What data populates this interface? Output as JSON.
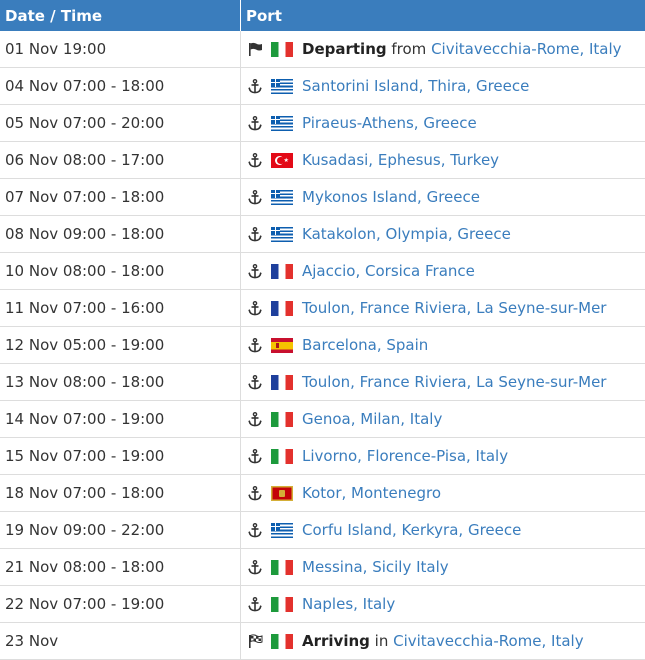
{
  "header": {
    "date_col": "Date / Time",
    "port_col": "Port"
  },
  "rows": [
    {
      "datetime": "01 Nov 19:00",
      "icon": "flag-icon",
      "flag": "it",
      "bold": "Departing",
      "pre": " from ",
      "port": "Civitavecchia-Rome, Italy"
    },
    {
      "datetime": "04 Nov 07:00 - 18:00",
      "icon": "anchor-icon",
      "flag": "gr",
      "bold": "",
      "pre": "",
      "port": "Santorini Island, Thira, Greece"
    },
    {
      "datetime": "05 Nov 07:00 - 20:00",
      "icon": "anchor-icon",
      "flag": "gr",
      "bold": "",
      "pre": "",
      "port": "Piraeus-Athens, Greece"
    },
    {
      "datetime": "06 Nov 08:00 - 17:00",
      "icon": "anchor-icon",
      "flag": "tr",
      "bold": "",
      "pre": "",
      "port": "Kusadasi, Ephesus, Turkey"
    },
    {
      "datetime": "07 Nov 07:00 - 18:00",
      "icon": "anchor-icon",
      "flag": "gr",
      "bold": "",
      "pre": "",
      "port": "Mykonos Island, Greece"
    },
    {
      "datetime": "08 Nov 09:00 - 18:00",
      "icon": "anchor-icon",
      "flag": "gr",
      "bold": "",
      "pre": "",
      "port": "Katakolon, Olympia, Greece"
    },
    {
      "datetime": "10 Nov 08:00 - 18:00",
      "icon": "anchor-icon",
      "flag": "fr",
      "bold": "",
      "pre": "",
      "port": "Ajaccio, Corsica France"
    },
    {
      "datetime": "11 Nov 07:00 - 16:00",
      "icon": "anchor-icon",
      "flag": "fr",
      "bold": "",
      "pre": "",
      "port": "Toulon, France Riviera, La Seyne-sur-Mer"
    },
    {
      "datetime": "12 Nov 05:00 - 19:00",
      "icon": "anchor-icon",
      "flag": "es",
      "bold": "",
      "pre": "",
      "port": "Barcelona, Spain"
    },
    {
      "datetime": "13 Nov 08:00 - 18:00",
      "icon": "anchor-icon",
      "flag": "fr",
      "bold": "",
      "pre": "",
      "port": "Toulon, France Riviera, La Seyne-sur-Mer"
    },
    {
      "datetime": "14 Nov 07:00 - 19:00",
      "icon": "anchor-icon",
      "flag": "it",
      "bold": "",
      "pre": "",
      "port": "Genoa, Milan, Italy"
    },
    {
      "datetime": "15 Nov 07:00 - 19:00",
      "icon": "anchor-icon",
      "flag": "it",
      "bold": "",
      "pre": "",
      "port": "Livorno, Florence-Pisa, Italy"
    },
    {
      "datetime": "18 Nov 07:00 - 18:00",
      "icon": "anchor-icon",
      "flag": "me",
      "bold": "",
      "pre": "",
      "port": "Kotor, Montenegro"
    },
    {
      "datetime": "19 Nov 09:00 - 22:00",
      "icon": "anchor-icon",
      "flag": "gr",
      "bold": "",
      "pre": "",
      "port": "Corfu Island, Kerkyra, Greece"
    },
    {
      "datetime": "21 Nov 08:00 - 18:00",
      "icon": "anchor-icon",
      "flag": "it",
      "bold": "",
      "pre": "",
      "port": "Messina, Sicily Italy"
    },
    {
      "datetime": "22 Nov 07:00 - 19:00",
      "icon": "anchor-icon",
      "flag": "it",
      "bold": "",
      "pre": "",
      "port": "Naples, Italy"
    },
    {
      "datetime": "23 Nov",
      "icon": "checkered-flag-icon",
      "flag": "it",
      "bold": "Arriving",
      "pre": " in ",
      "port": "Civitavecchia-Rome, Italy"
    }
  ],
  "colors": {
    "header_bg": "#3a7dbd",
    "link": "#3a7dbd",
    "border": "#dddddd"
  }
}
